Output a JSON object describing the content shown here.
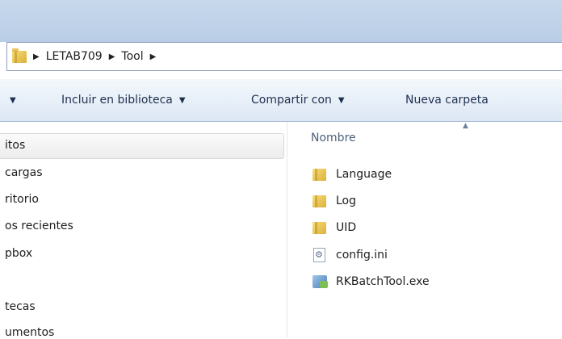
{
  "address_bar": {
    "breadcrumbs": [
      "LETAB709",
      "Tool"
    ],
    "separator": "▶"
  },
  "toolbar": {
    "organize_arrow": "▼",
    "include_library_label": "Incluir en biblioteca",
    "share_with_label": "Compartir con",
    "new_folder_label": "Nueva carpeta",
    "dropdown_arrow": "▼"
  },
  "nav": {
    "items": [
      {
        "label": "itos",
        "selected": true
      },
      {
        "label": "cargas"
      },
      {
        "label": "ritorio"
      },
      {
        "label": "os recientes"
      },
      {
        "label": "pbox"
      },
      {
        "label": "tecas"
      },
      {
        "label": "umentos"
      }
    ]
  },
  "files": {
    "column_header": "Nombre",
    "sort_indicator": "▲",
    "items": [
      {
        "name": "Language",
        "icon": "folder-icon"
      },
      {
        "name": "Log",
        "icon": "folder-icon"
      },
      {
        "name": "UID",
        "icon": "folder-icon"
      },
      {
        "name": "config.ini",
        "icon": "settings-file-icon"
      },
      {
        "name": "RKBatchTool.exe",
        "icon": "application-icon"
      }
    ]
  },
  "colors": {
    "title_bar": "#c7d8ec",
    "toolbar_text": "#1e3050",
    "folder_yellow": "#f0cf5e"
  }
}
